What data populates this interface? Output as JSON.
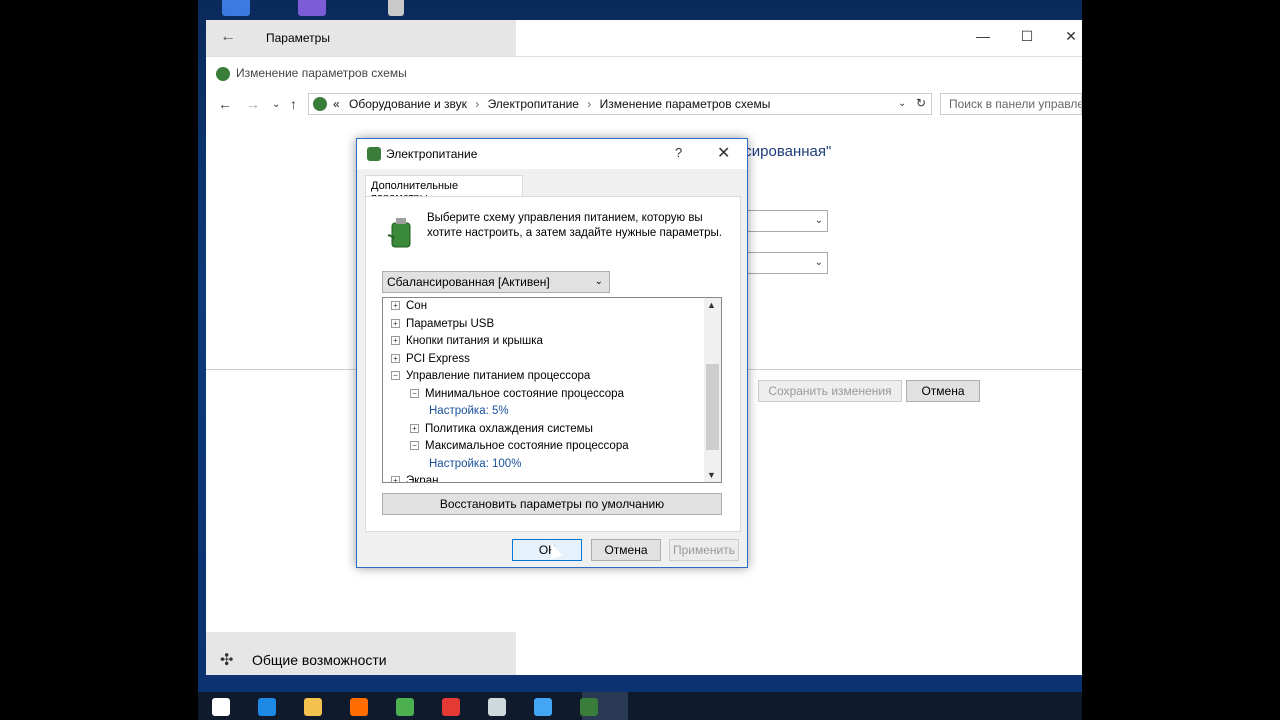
{
  "settings_window": {
    "title": "Параметры",
    "accessibility_label": "Общие возможности",
    "window_buttons": [
      "—",
      "☐",
      "✕"
    ]
  },
  "control_panel": {
    "title": "Изменение параметров схемы",
    "address": {
      "prefix": "«",
      "crumbs": [
        "Оборудование и звук",
        "Электропитание",
        "Изменение параметров схемы"
      ],
      "separator": "›"
    },
    "search_placeholder": "Поиск в панели управле",
    "heading_tail": "нсированная\"",
    "save_label": "Сохранить изменения",
    "cancel_label": "Отмена"
  },
  "dialog": {
    "title": "Электропитание",
    "help": "?",
    "close": "✕",
    "tab_label": "Дополнительные параметры",
    "description": "Выберите схему управления питанием, которую вы хотите настроить, а затем задайте нужные параметры.",
    "scheme": "Сбалансированная [Активен]",
    "tree": [
      {
        "label": "Сон",
        "level": 0,
        "expander": "+",
        "kind": "group"
      },
      {
        "label": "Параметры USB",
        "level": 0,
        "expander": "+",
        "kind": "group"
      },
      {
        "label": "Кнопки питания и крышка",
        "level": 0,
        "expander": "+",
        "kind": "group"
      },
      {
        "label": "PCI Express",
        "level": 0,
        "expander": "+",
        "kind": "group"
      },
      {
        "label": "Управление питанием процессора",
        "level": 0,
        "expander": "−",
        "kind": "group"
      },
      {
        "label": "Минимальное состояние процессора",
        "level": 1,
        "expander": "−",
        "kind": "group"
      },
      {
        "label": "Настройка: 5%",
        "level": 2,
        "expander": "",
        "kind": "setting"
      },
      {
        "label": "Политика охлаждения системы",
        "level": 1,
        "expander": "+",
        "kind": "group"
      },
      {
        "label": "Максимальное состояние процессора",
        "level": 1,
        "expander": "−",
        "kind": "group"
      },
      {
        "label": "Настройка: 100%",
        "level": 2,
        "expander": "",
        "kind": "setting"
      },
      {
        "label": "Экран",
        "level": 0,
        "expander": "+",
        "kind": "group"
      }
    ],
    "restore_label": "Восстановить параметры по умолчанию",
    "ok_label": "ОК",
    "cancel_label": "Отмена",
    "apply_label": "Применить"
  },
  "taskbar": {
    "items": [
      "start-icon",
      "edge-icon",
      "explorer-icon",
      "firefox-icon",
      "utorrent-icon",
      "app-icon",
      "settings-icon",
      "control-panel-icon",
      "power-icon"
    ],
    "colors": [
      "#ffffff",
      "#1e88e5",
      "#f2c14e",
      "#ff6d00",
      "#4caf50",
      "#e53935",
      "#cfd8dc",
      "#42a5f5",
      "#3a7d3a"
    ]
  }
}
